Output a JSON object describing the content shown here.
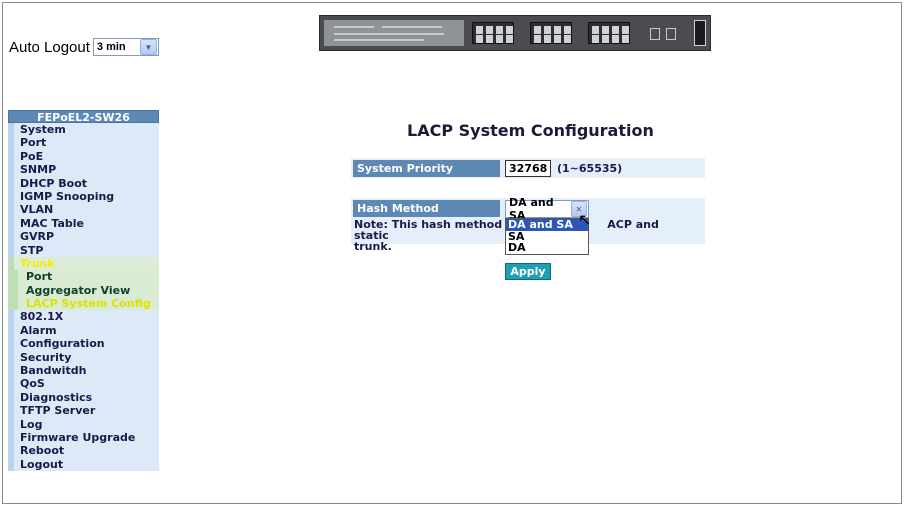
{
  "logout": {
    "label": "Auto Logout",
    "selected": "3 min"
  },
  "sidebar": {
    "header": "FEPoEL2-SW26",
    "items": [
      {
        "label": "System"
      },
      {
        "label": "Port"
      },
      {
        "label": "PoE"
      },
      {
        "label": "SNMP"
      },
      {
        "label": "DHCP Boot"
      },
      {
        "label": "IGMP Snooping"
      },
      {
        "label": "VLAN"
      },
      {
        "label": "MAC Table"
      },
      {
        "label": "GVRP"
      },
      {
        "label": "STP"
      },
      {
        "label": "Trunk"
      },
      {
        "label": "Port"
      },
      {
        "label": "Aggregator View"
      },
      {
        "label": "LACP System Config"
      },
      {
        "label": "802.1X"
      },
      {
        "label": "Alarm"
      },
      {
        "label": "Configuration"
      },
      {
        "label": "Security"
      },
      {
        "label": "Bandwitdh"
      },
      {
        "label": "QoS"
      },
      {
        "label": "Diagnostics"
      },
      {
        "label": "TFTP Server"
      },
      {
        "label": "Log"
      },
      {
        "label": "Firmware Upgrade"
      },
      {
        "label": "Reboot"
      },
      {
        "label": "Logout"
      }
    ]
  },
  "main": {
    "title": "LACP System Configuration",
    "system_priority": {
      "label": "System Priority",
      "value": "32768",
      "range": "(1~65535)"
    },
    "hash_method": {
      "label": "Hash Method",
      "selected": "DA and SA",
      "options": [
        "DA and SA",
        "SA",
        "DA"
      ]
    },
    "note_prefix": "Note: This hash method ap",
    "note_suffix": "ACP and static",
    "note_line2": "trunk.",
    "apply_label": "Apply"
  },
  "colors": {
    "header_blue": "#5f89b5",
    "row_bg": "#e5effa",
    "apply": "#1ea0b2",
    "active_menu": "#f0f000"
  }
}
